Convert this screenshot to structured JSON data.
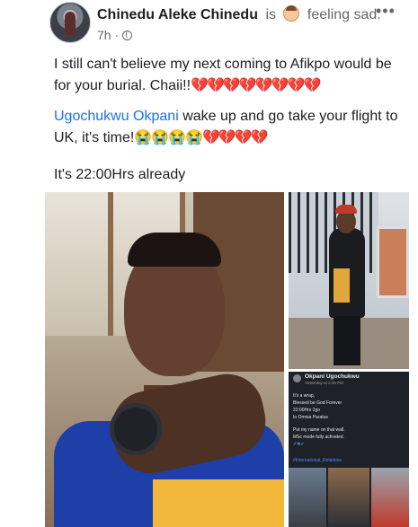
{
  "post": {
    "author": "Chinedu Aleke Chinedu",
    "is_text": "is",
    "feeling": "feeling sad.",
    "time": "7h",
    "more": "•••",
    "text1": "I still can't believe my next coming to Afikpo would be for your burial. Chaii!!",
    "hearts1": "💔💔💔💔💔💔💔💔",
    "mention": "Ugochukwu Okpani",
    "text2": " wake up and go take your flight to UK, it's time!",
    "crying": "😭😭😭😭",
    "hearts2": "💔💔💔💔",
    "text3": "It's 22:00Hrs already"
  },
  "embedded_screenshot": {
    "name": "Okpani Ugochukwu",
    "time": "Yesterday at 4:25 PM",
    "lines": [
      "It's a wrap,",
      "Blessed be God Forever",
      "22:00Hrs 2go",
      "In Omnia Paratus",
      "",
      "Put my name on that wall.",
      "MSc mode fully activated.",
      "✔✖✔"
    ],
    "hashtag": "#International_Relations"
  }
}
